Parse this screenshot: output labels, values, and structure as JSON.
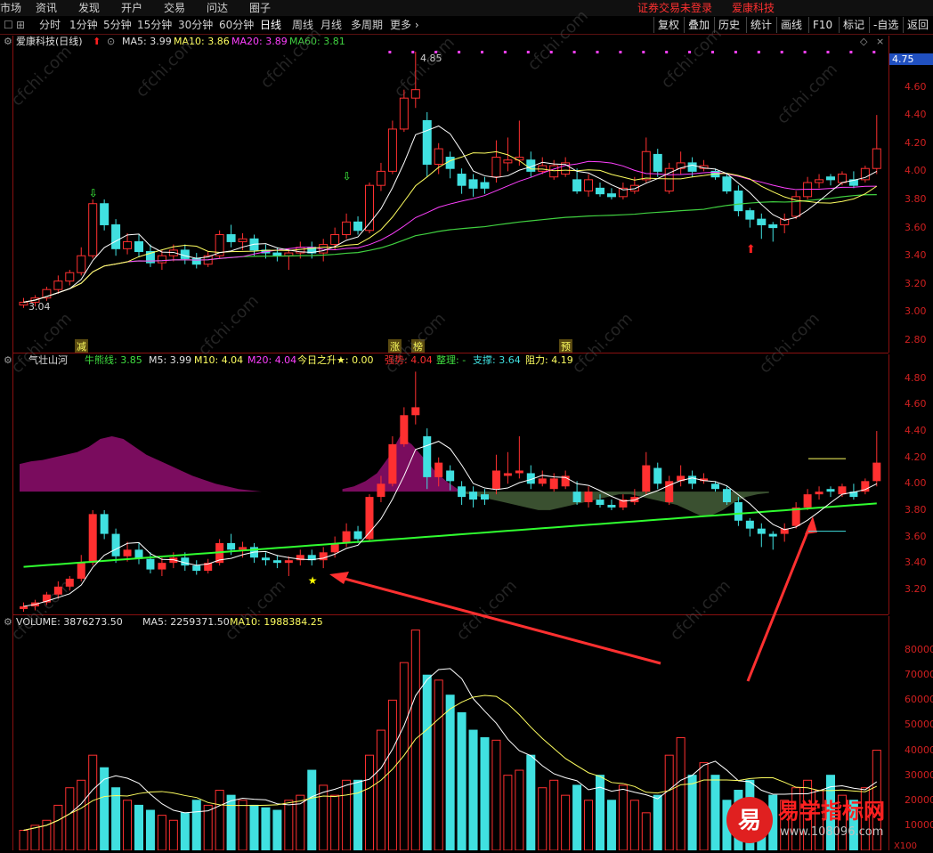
{
  "topbar": {
    "items": [
      "市场",
      "资讯",
      "发现",
      "开户",
      "交易",
      "问达",
      "圈子"
    ],
    "status_login": "证券交易未登录",
    "stock_name": "爱康科技"
  },
  "toolbar": {
    "periods": [
      "分时",
      "1分钟",
      "5分钟",
      "15分钟",
      "30分钟",
      "60分钟",
      "日线",
      "周线",
      "月线",
      "多周期",
      "更多"
    ],
    "active_period": "日线",
    "right_buttons": [
      "复权",
      "叠加",
      "历史",
      "统计",
      "画线",
      "F10",
      "标记",
      "-自选",
      "返回"
    ]
  },
  "main_panel": {
    "title": "爱康科技(日线)",
    "ma5_label": "MA5: 3.99",
    "ma10_label": "MA10: 3.86",
    "ma20_label": "MA20: 3.89",
    "ma60_label": "MA60: 3.81",
    "price_tag": "4.75",
    "high_label": "4.85",
    "low_label": "3.04",
    "axis_ticks": [
      "4.60",
      "4.40",
      "4.20",
      "4.00",
      "3.80",
      "3.60",
      "3.40",
      "3.20",
      "3.00",
      "2.80"
    ],
    "markers": [
      "减",
      "涨",
      "榜",
      "预"
    ]
  },
  "indicator_panel": {
    "title": "气壮山河",
    "niu_label": "牛熊线: 3.85",
    "m5_label": "M5: 3.99",
    "m10_label": "M10: 4.04",
    "m20_label": "M20: 4.04",
    "today_label": "今日之升★: 0.00",
    "strong_label": "强势: 4.04",
    "arrange_label": "整理: -",
    "support_label": "支撑: 3.64",
    "resist_label": "阻力: 4.19",
    "axis_ticks": [
      "4.80",
      "4.60",
      "4.40",
      "4.20",
      "4.00",
      "3.80",
      "3.60",
      "3.40",
      "3.20"
    ]
  },
  "volume_panel": {
    "volume_label": "VOLUME: 3876273.50",
    "ma5_label": "MA5: 2259371.50",
    "ma10_label": "MA10: 1988384.25",
    "axis_ticks": [
      "80000",
      "70000",
      "60000",
      "50000",
      "40000",
      "30000",
      "20000",
      "10000"
    ],
    "unit": "X100"
  },
  "watermark": "cfchi.com",
  "logo": {
    "char": "易",
    "text": "易学指标网",
    "url": "www.108096.com"
  },
  "colors": {
    "up": "#ff3030",
    "down": "#40e0e0",
    "ma5": "#ffffff",
    "ma10": "#ffff60",
    "ma20": "#ff40ff",
    "ma60": "#40d040",
    "axis": "#d02020",
    "purple": "#7a0c5e",
    "olive": "#3a5030"
  },
  "chart_data": [
    {
      "type": "candlestick",
      "title": "爱康科技(日线)",
      "ylim": [
        2.75,
        4.85
      ],
      "candles": [
        {
          "o": 3.05,
          "c": 3.07,
          "h": 3.1,
          "l": 3.03
        },
        {
          "o": 3.07,
          "c": 3.1,
          "h": 3.12,
          "l": 3.04
        },
        {
          "o": 3.1,
          "c": 3.16,
          "h": 3.18,
          "l": 3.08
        },
        {
          "o": 3.16,
          "c": 3.22,
          "h": 3.26,
          "l": 3.13
        },
        {
          "o": 3.22,
          "c": 3.28,
          "h": 3.3,
          "l": 3.19
        },
        {
          "o": 3.28,
          "c": 3.4,
          "h": 3.46,
          "l": 3.26
        },
        {
          "o": 3.4,
          "c": 3.77,
          "h": 3.8,
          "l": 3.38
        },
        {
          "o": 3.77,
          "c": 3.62,
          "h": 3.8,
          "l": 3.58
        },
        {
          "o": 3.62,
          "c": 3.45,
          "h": 3.66,
          "l": 3.4
        },
        {
          "o": 3.45,
          "c": 3.5,
          "h": 3.56,
          "l": 3.41
        },
        {
          "o": 3.5,
          "c": 3.43,
          "h": 3.55,
          "l": 3.39
        },
        {
          "o": 3.43,
          "c": 3.35,
          "h": 3.48,
          "l": 3.32
        },
        {
          "o": 3.35,
          "c": 3.4,
          "h": 3.44,
          "l": 3.3
        },
        {
          "o": 3.4,
          "c": 3.44,
          "h": 3.48,
          "l": 3.36
        },
        {
          "o": 3.44,
          "c": 3.38,
          "h": 3.48,
          "l": 3.34
        },
        {
          "o": 3.38,
          "c": 3.34,
          "h": 3.42,
          "l": 3.31
        },
        {
          "o": 3.34,
          "c": 3.4,
          "h": 3.43,
          "l": 3.32
        },
        {
          "o": 3.4,
          "c": 3.55,
          "h": 3.58,
          "l": 3.38
        },
        {
          "o": 3.55,
          "c": 3.5,
          "h": 3.62,
          "l": 3.46
        },
        {
          "o": 3.5,
          "c": 3.52,
          "h": 3.56,
          "l": 3.44
        },
        {
          "o": 3.52,
          "c": 3.44,
          "h": 3.55,
          "l": 3.4
        },
        {
          "o": 3.44,
          "c": 3.42,
          "h": 3.48,
          "l": 3.38
        },
        {
          "o": 3.42,
          "c": 3.4,
          "h": 3.46,
          "l": 3.36
        },
        {
          "o": 3.4,
          "c": 3.42,
          "h": 3.45,
          "l": 3.3
        },
        {
          "o": 3.42,
          "c": 3.46,
          "h": 3.5,
          "l": 3.38
        },
        {
          "o": 3.46,
          "c": 3.42,
          "h": 3.5,
          "l": 3.38
        },
        {
          "o": 3.42,
          "c": 3.48,
          "h": 3.52,
          "l": 3.36
        },
        {
          "o": 3.48,
          "c": 3.55,
          "h": 3.6,
          "l": 3.44
        },
        {
          "o": 3.55,
          "c": 3.64,
          "h": 3.7,
          "l": 3.52
        },
        {
          "o": 3.64,
          "c": 3.58,
          "h": 3.68,
          "l": 3.55
        },
        {
          "o": 3.58,
          "c": 3.9,
          "h": 3.92,
          "l": 3.56
        },
        {
          "o": 3.9,
          "c": 4.0,
          "h": 4.06,
          "l": 3.86
        },
        {
          "o": 4.0,
          "c": 4.3,
          "h": 4.36,
          "l": 3.98
        },
        {
          "o": 4.3,
          "c": 4.52,
          "h": 4.58,
          "l": 4.28
        },
        {
          "o": 4.52,
          "c": 4.58,
          "h": 4.85,
          "l": 4.45
        },
        {
          "o": 4.36,
          "c": 4.05,
          "h": 4.42,
          "l": 3.96
        },
        {
          "o": 4.05,
          "c": 4.16,
          "h": 4.2,
          "l": 3.98
        },
        {
          "o": 4.1,
          "c": 4.02,
          "h": 4.14,
          "l": 3.95
        },
        {
          "o": 3.98,
          "c": 3.9,
          "h": 4.02,
          "l": 3.84
        },
        {
          "o": 3.94,
          "c": 3.88,
          "h": 3.98,
          "l": 3.82
        },
        {
          "o": 3.92,
          "c": 3.88,
          "h": 3.96,
          "l": 3.84
        },
        {
          "o": 3.96,
          "c": 4.1,
          "h": 4.22,
          "l": 3.92
        },
        {
          "o": 4.06,
          "c": 4.08,
          "h": 4.24,
          "l": 4.0
        },
        {
          "o": 4.08,
          "c": 4.1,
          "h": 4.36,
          "l": 4.04
        },
        {
          "o": 4.08,
          "c": 4.0,
          "h": 4.14,
          "l": 3.96
        },
        {
          "o": 4.0,
          "c": 4.04,
          "h": 4.1,
          "l": 3.98
        },
        {
          "o": 3.96,
          "c": 4.04,
          "h": 4.08,
          "l": 3.94
        },
        {
          "o": 3.98,
          "c": 4.06,
          "h": 4.1,
          "l": 3.96
        },
        {
          "o": 3.94,
          "c": 3.86,
          "h": 4.02,
          "l": 3.84
        },
        {
          "o": 3.86,
          "c": 3.94,
          "h": 3.98,
          "l": 3.82
        },
        {
          "o": 3.88,
          "c": 3.84,
          "h": 3.92,
          "l": 3.82
        },
        {
          "o": 3.84,
          "c": 3.82,
          "h": 3.88,
          "l": 3.8
        },
        {
          "o": 3.82,
          "c": 3.88,
          "h": 3.92,
          "l": 3.8
        },
        {
          "o": 3.86,
          "c": 3.9,
          "h": 3.96,
          "l": 3.84
        },
        {
          "o": 3.94,
          "c": 4.14,
          "h": 4.24,
          "l": 3.92
        },
        {
          "o": 4.12,
          "c": 4.0,
          "h": 4.16,
          "l": 3.96
        },
        {
          "o": 3.86,
          "c": 4.02,
          "h": 4.06,
          "l": 3.84
        },
        {
          "o": 4.02,
          "c": 4.06,
          "h": 4.14,
          "l": 3.98
        },
        {
          "o": 4.06,
          "c": 4.0,
          "h": 4.1,
          "l": 3.96
        },
        {
          "o": 4.02,
          "c": 4.04,
          "h": 4.08,
          "l": 4.0
        },
        {
          "o": 4.0,
          "c": 3.96,
          "h": 4.02,
          "l": 3.94
        },
        {
          "o": 3.96,
          "c": 3.86,
          "h": 3.98,
          "l": 3.84
        },
        {
          "o": 3.86,
          "c": 3.72,
          "h": 3.9,
          "l": 3.68
        },
        {
          "o": 3.72,
          "c": 3.66,
          "h": 3.74,
          "l": 3.6
        },
        {
          "o": 3.66,
          "c": 3.62,
          "h": 3.7,
          "l": 3.52
        },
        {
          "o": 3.62,
          "c": 3.6,
          "h": 3.64,
          "l": 3.5
        },
        {
          "o": 3.62,
          "c": 3.66,
          "h": 3.7,
          "l": 3.56
        },
        {
          "o": 3.68,
          "c": 3.82,
          "h": 3.86,
          "l": 3.66
        },
        {
          "o": 3.82,
          "c": 3.92,
          "h": 3.96,
          "l": 3.8
        },
        {
          "o": 3.92,
          "c": 3.94,
          "h": 3.98,
          "l": 3.88
        },
        {
          "o": 3.96,
          "c": 3.94,
          "h": 3.98,
          "l": 3.9
        },
        {
          "o": 3.92,
          "c": 3.98,
          "h": 4.0,
          "l": 3.9
        },
        {
          "o": 3.94,
          "c": 3.9,
          "h": 4.0,
          "l": 3.88
        },
        {
          "o": 3.94,
          "c": 4.02,
          "h": 4.04,
          "l": 3.92
        },
        {
          "o": 4.02,
          "c": 4.16,
          "h": 4.4,
          "l": 3.98
        }
      ]
    },
    {
      "type": "bar",
      "title": "VOLUME",
      "ylim": [
        0,
        90000
      ],
      "values": [
        8000,
        10000,
        12000,
        18000,
        25000,
        28000,
        38000,
        33000,
        25000,
        20000,
        18000,
        16000,
        14000,
        12000,
        15000,
        20000,
        18000,
        24000,
        22000,
        20000,
        18000,
        17000,
        16000,
        20000,
        22000,
        32000,
        26000,
        22000,
        28000,
        28000,
        38000,
        48000,
        60000,
        75000,
        88000,
        70000,
        68000,
        62000,
        55000,
        48000,
        45000,
        44000,
        30000,
        32000,
        38000,
        25000,
        28000,
        22000,
        26000,
        20000,
        30000,
        20000,
        26000,
        20000,
        15000,
        22000,
        38000,
        45000,
        30000,
        35000,
        30000,
        20000,
        24000,
        28000,
        18000,
        22000,
        20000,
        25000,
        28000,
        24000,
        30000,
        22000,
        20000,
        25000,
        40000
      ]
    }
  ]
}
